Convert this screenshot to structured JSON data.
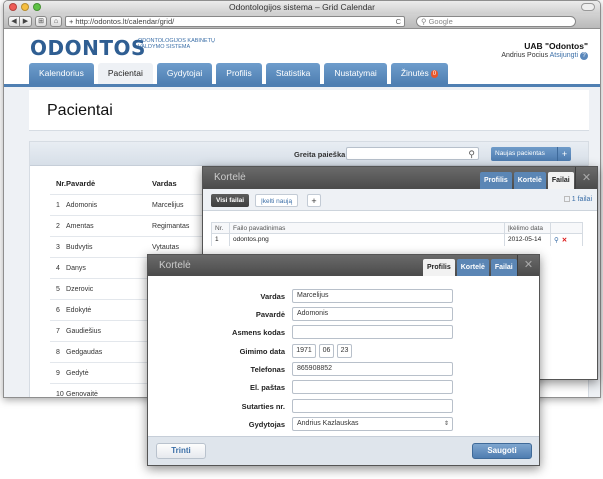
{
  "browser": {
    "window_title": "Odontologijos sistema – Grid Calendar",
    "url": "http://odontos.lt/calendar/grid/",
    "search_placeholder": "Google",
    "back_glyph": "◀",
    "forward_glyph": "▶",
    "reader_glyph": "⊞",
    "home_glyph": "⌂",
    "add_glyph": "+",
    "reload_glyph": "C"
  },
  "header": {
    "logo": "ODONTOS",
    "logo_sub": "ODONTOLOGIJOS KABINETŲ VALDYMO SISTEMA",
    "company": "UAB \"Odontos\"",
    "user": "Andrius Pocius",
    "logout": "Atsijungti",
    "help_glyph": "?"
  },
  "nav": {
    "tabs": [
      {
        "label": "Kalendorius"
      },
      {
        "label": "Pacientai"
      },
      {
        "label": "Gydytojai"
      },
      {
        "label": "Profilis"
      },
      {
        "label": "Statistika"
      },
      {
        "label": "Nustatymai"
      },
      {
        "label": "Žinutės"
      }
    ],
    "messages_badge": "0"
  },
  "page": {
    "title": "Pacientai"
  },
  "patients": {
    "quick_search_label": "Greita paieška",
    "search_glyph": "⚲",
    "new_patient": "Naujas pacientas",
    "plus": "+",
    "columns": {
      "nr": "Nr.",
      "surname": "Pavardė",
      "name": "Vardas"
    },
    "rows": [
      {
        "nr": "1",
        "surname": "Adomonis",
        "name": "Marcelijus"
      },
      {
        "nr": "2",
        "surname": "Amentas",
        "name": "Regimantas"
      },
      {
        "nr": "3",
        "surname": "Budvytis",
        "name": "Vytautas"
      },
      {
        "nr": "4",
        "surname": "Danys",
        "name": ""
      },
      {
        "nr": "5",
        "surname": "Dzerovic",
        "name": ""
      },
      {
        "nr": "6",
        "surname": "Edokytė",
        "name": ""
      },
      {
        "nr": "7",
        "surname": "Gaudiešius",
        "name": ""
      },
      {
        "nr": "8",
        "surname": "Gedgaudas",
        "name": ""
      },
      {
        "nr": "9",
        "surname": "Gedytė",
        "name": ""
      },
      {
        "nr": "10",
        "surname": "Genovaitė",
        "name": ""
      }
    ]
  },
  "files_dialog": {
    "title": "Kortelė",
    "tabs": {
      "profile": "Profilis",
      "card": "Kortelė",
      "files": "Failai"
    },
    "close": "✕",
    "subtabs": {
      "all": "Visi failai",
      "upload": "Įkelti naują",
      "add": "+"
    },
    "count": "1 failai",
    "columns": {
      "nr": "Nr.",
      "name": "Failo pavadinimas",
      "date": "Įkėlimo data"
    },
    "files": [
      {
        "nr": "1",
        "name": "odontos.png",
        "date": "2012-05-14",
        "view_glyph": "⚲",
        "delete_glyph": "✕"
      }
    ]
  },
  "profile_dialog": {
    "title": "Kortelė",
    "tabs": {
      "profile": "Profilis",
      "card": "Kortelė",
      "files": "Failai"
    },
    "close": "✕",
    "fields": {
      "first_name": {
        "label": "Vardas",
        "value": "Marcelijus"
      },
      "last_name": {
        "label": "Pavardė",
        "value": "Adomonis"
      },
      "personal_code": {
        "label": "Asmens kodas",
        "value": ""
      },
      "birth_date": {
        "label": "Gimimo data",
        "year": "1971",
        "month": "06",
        "day": "23"
      },
      "phone": {
        "label": "Telefonas",
        "value": "865908852"
      },
      "email": {
        "label": "El. paštas",
        "value": ""
      },
      "contract": {
        "label": "Sutarties nr.",
        "value": ""
      },
      "doctor": {
        "label": "Gydytojas",
        "value": "Andrius Kazlauskas",
        "arrow": "⇕"
      }
    },
    "delete_button": "Trinti",
    "save_button": "Saugoti"
  },
  "colors": {
    "brand": "#2f5e92",
    "nav_tab": "#5b88bb",
    "dialog_header": "#555555",
    "save_button": "#4f7db1",
    "delete_icon": "#dd1111"
  }
}
